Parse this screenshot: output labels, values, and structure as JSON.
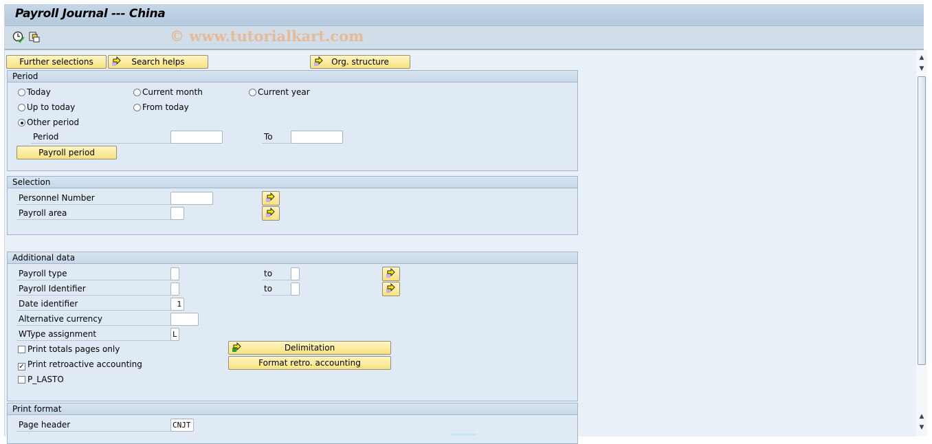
{
  "window": {
    "title": "Payroll Journal --- China"
  },
  "toolbar": {
    "icons": [
      "execute-background-icon",
      "get-variant-icon"
    ],
    "watermark": "© www.tutorialkart.com"
  },
  "buttons": {
    "further_selections": "Further selections",
    "search_helps": "Search helps",
    "org_structure": "Org. structure"
  },
  "period": {
    "title": "Period",
    "radios": [
      {
        "label": "Today",
        "selected": false
      },
      {
        "label": "Current month",
        "selected": false
      },
      {
        "label": "Current year",
        "selected": false
      },
      {
        "label": "Up to today",
        "selected": false
      },
      {
        "label": "From today",
        "selected": false
      },
      {
        "label": "Other period",
        "selected": true
      }
    ],
    "period_label": "Period",
    "period_from": "",
    "to_label": "To",
    "period_to": "",
    "payroll_period_button": "Payroll period"
  },
  "selection": {
    "title": "Selection",
    "fields": [
      {
        "label": "Personnel Number",
        "value": ""
      },
      {
        "label": "Payroll area",
        "value": ""
      }
    ]
  },
  "additional": {
    "title": "Additional data",
    "payroll_type": {
      "label": "Payroll type",
      "from": "",
      "to_label": "to",
      "to": ""
    },
    "payroll_identifier": {
      "label": "Payroll Identifier",
      "from": "",
      "to_label": "to",
      "to": ""
    },
    "date_identifier": {
      "label": "Date identifier",
      "value": "1"
    },
    "alt_currency": {
      "label": "Alternative currency",
      "value": ""
    },
    "wtype_assignment": {
      "label": "WType assignment",
      "value": "L"
    },
    "checkboxes": [
      {
        "label": "Print totals pages only",
        "checked": false
      },
      {
        "label": "Print retroactive accounting",
        "checked": true
      },
      {
        "label": "P_LASTO",
        "checked": false
      }
    ],
    "delimitation_button": "Delimitation",
    "format_retro_button": "Format retro. accounting"
  },
  "print_format": {
    "title": "Print format",
    "page_header": {
      "label": "Page header",
      "value": "CNJT"
    }
  },
  "scrollbar": {
    "up": "▲",
    "down": "▼"
  }
}
